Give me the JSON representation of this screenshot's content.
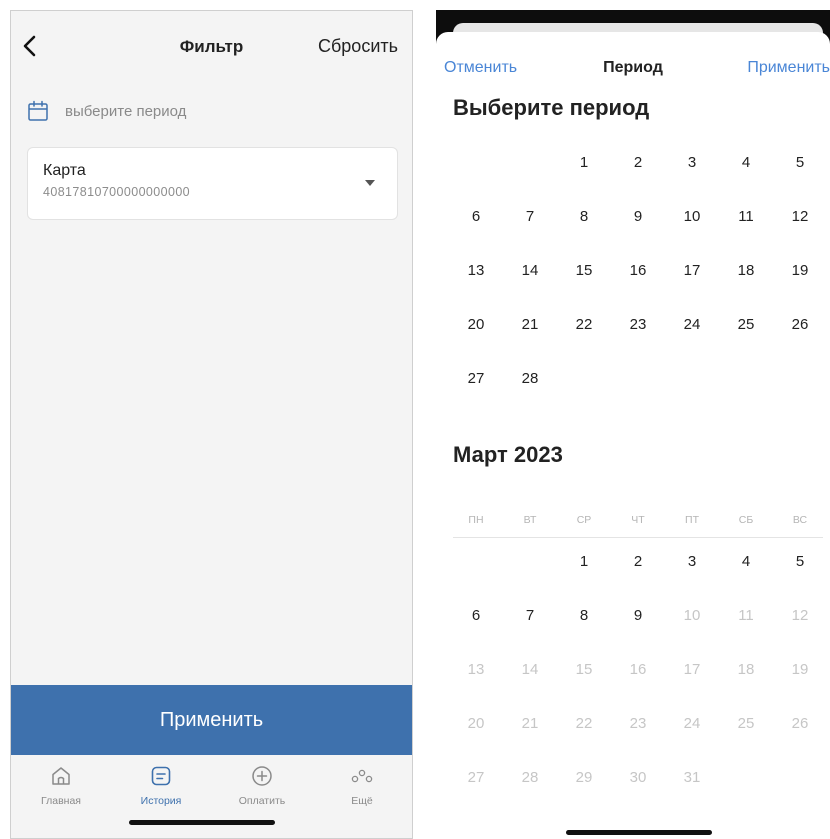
{
  "filter_screen": {
    "title": "Фильтр",
    "reset_label": "Сбросить",
    "period_placeholder": "выберите период",
    "card": {
      "label": "Карта",
      "number": "40817810700000000000"
    },
    "apply_label": "Применить",
    "tabs": [
      {
        "label": "Главная",
        "icon": "home-icon",
        "active": false
      },
      {
        "label": "История",
        "icon": "history-icon",
        "active": true
      },
      {
        "label": "Оплатить",
        "icon": "plus-circle-icon",
        "active": false
      },
      {
        "label": "Ещё",
        "icon": "more-icon",
        "active": false
      }
    ],
    "colors": {
      "accent": "#3e71ad",
      "background": "#f4f4f4",
      "muted": "#8a8a8a"
    }
  },
  "period_sheet": {
    "cancel_label": "Отменить",
    "title": "Период",
    "apply_label": "Применить",
    "heading": "Выберите период",
    "previous_month": {
      "days": [
        "",
        "",
        "1",
        "2",
        "3",
        "4",
        "5",
        "6",
        "7",
        "8",
        "9",
        "10",
        "11",
        "12",
        "13",
        "14",
        "15",
        "16",
        "17",
        "18",
        "19",
        "20",
        "21",
        "22",
        "23",
        "24",
        "25",
        "26",
        "27",
        "28"
      ]
    },
    "current_month": {
      "title": "Март 2023",
      "weekdays": [
        "ПН",
        "ВТ",
        "СР",
        "ЧТ",
        "ПТ",
        "СБ",
        "ВС"
      ],
      "days": [
        "",
        "",
        "1",
        "2",
        "3",
        "4",
        "5",
        "6",
        "7",
        "8",
        "9",
        "10",
        "11",
        "12",
        "13",
        "14",
        "15",
        "16",
        "17",
        "18",
        "19",
        "20",
        "21",
        "22",
        "23",
        "24",
        "25",
        "26",
        "27",
        "28",
        "29",
        "30",
        "31"
      ],
      "last_enabled_day": 9
    },
    "colors": {
      "link": "#4a86d6",
      "disabled_day": "#c6c6c6"
    }
  }
}
